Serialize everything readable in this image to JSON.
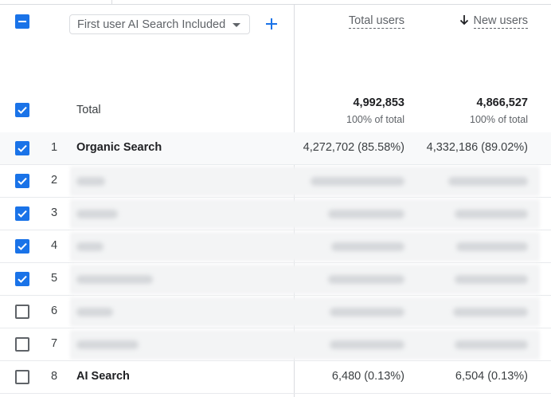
{
  "toolbar": {
    "dimension_label": "First user AI Search Included",
    "add_icon": "plus-icon",
    "dropdown_icon": "caret-down-icon"
  },
  "columns": {
    "total_users": "Total users",
    "new_users": "New users",
    "sort_icon": "arrow-down-icon"
  },
  "totals": {
    "label": "Total",
    "total_users": "4,992,853",
    "total_users_pct": "100% of total",
    "new_users": "4,866,527",
    "new_users_pct": "100% of total"
  },
  "rows": [
    {
      "num": "1",
      "name": "Organic Search",
      "total_users": "4,272,702 (85.58%)",
      "new_users": "4,332,186 (89.02%)",
      "checked": true,
      "redacted": false
    },
    {
      "num": "2",
      "name": "",
      "total_users": "",
      "new_users": "",
      "checked": true,
      "redacted": true
    },
    {
      "num": "3",
      "name": "",
      "total_users": "",
      "new_users": "",
      "checked": true,
      "redacted": true
    },
    {
      "num": "4",
      "name": "",
      "total_users": "",
      "new_users": "",
      "checked": true,
      "redacted": true
    },
    {
      "num": "5",
      "name": "",
      "total_users": "",
      "new_users": "",
      "checked": true,
      "redacted": true
    },
    {
      "num": "6",
      "name": "",
      "total_users": "",
      "new_users": "",
      "checked": false,
      "redacted": true
    },
    {
      "num": "7",
      "name": "",
      "total_users": "",
      "new_users": "",
      "checked": false,
      "redacted": true
    },
    {
      "num": "8",
      "name": "AI Search",
      "total_users": "6,480 (0.13%)",
      "new_users": "6,504 (0.13%)",
      "checked": false,
      "redacted": false
    }
  ],
  "colors": {
    "checkbox_accent": "#1a73e8",
    "divider": "#dadce0",
    "muted_text": "#5f6368"
  }
}
